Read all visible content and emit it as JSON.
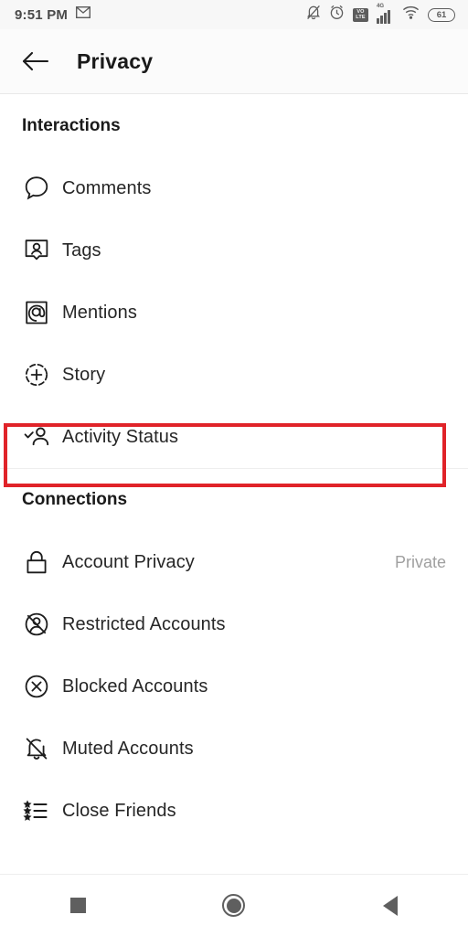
{
  "status_bar": {
    "time": "9:51 PM",
    "left_icons": [
      {
        "name": "gmail-icon",
        "label": "M"
      }
    ],
    "right_icons": [
      {
        "name": "notifications-off-icon"
      },
      {
        "name": "alarm-icon"
      },
      {
        "name": "volte-icon",
        "line1": "VO",
        "line2": "LTE"
      },
      {
        "name": "cellular-signal-icon",
        "network": "4G"
      },
      {
        "name": "wifi-icon"
      }
    ],
    "battery_level": "61"
  },
  "header": {
    "back_label": "back",
    "title": "Privacy"
  },
  "sections": [
    {
      "title": "Interactions",
      "rows": [
        {
          "icon": "comment-icon",
          "label": "Comments",
          "value": ""
        },
        {
          "icon": "tag-person-icon",
          "label": "Tags",
          "value": ""
        },
        {
          "icon": "mention-at-icon",
          "label": "Mentions",
          "value": ""
        },
        {
          "icon": "story-plus-icon",
          "label": "Story",
          "value": ""
        },
        {
          "icon": "activity-status-icon",
          "label": "Activity Status",
          "value": "",
          "highlighted": true
        }
      ]
    },
    {
      "title": "Connections",
      "rows": [
        {
          "icon": "lock-icon",
          "label": "Account Privacy",
          "value": "Private"
        },
        {
          "icon": "restricted-account-icon",
          "label": "Restricted Accounts",
          "value": ""
        },
        {
          "icon": "blocked-account-icon",
          "label": "Blocked Accounts",
          "value": ""
        },
        {
          "icon": "muted-bell-icon",
          "label": "Muted Accounts",
          "value": ""
        },
        {
          "icon": "close-friends-star-list-icon",
          "label": "Close Friends",
          "value": ""
        }
      ]
    }
  ],
  "highlight": {
    "color": "#e02329",
    "target": "Activity Status"
  },
  "nav_bar": {
    "buttons": [
      {
        "name": "recents-square-icon",
        "label": "Recents"
      },
      {
        "name": "home-circle-icon",
        "label": "Home"
      },
      {
        "name": "back-triangle-icon",
        "label": "Back"
      }
    ]
  }
}
